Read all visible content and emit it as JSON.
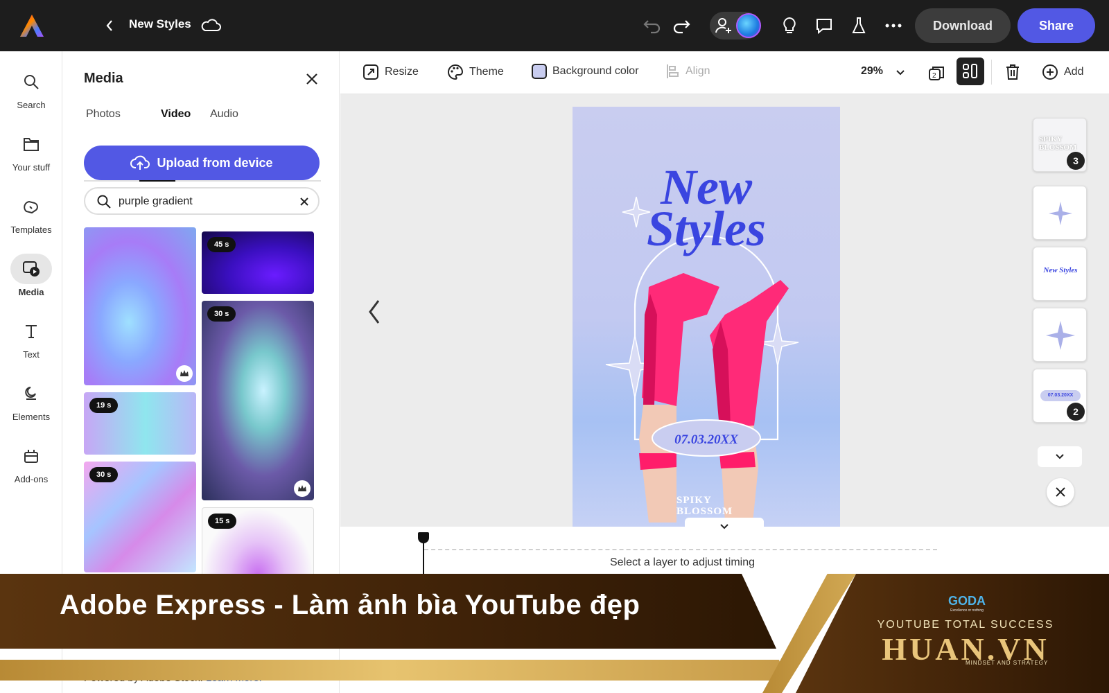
{
  "header": {
    "doc_title": "New Styles",
    "download_label": "Download",
    "share_label": "Share"
  },
  "rail": {
    "items": [
      {
        "label": "Search",
        "icon": "search-icon"
      },
      {
        "label": "Your stuff",
        "icon": "folder-icon"
      },
      {
        "label": "Templates",
        "icon": "templates-icon"
      },
      {
        "label": "Media",
        "icon": "media-icon",
        "active": true
      },
      {
        "label": "Text",
        "icon": "text-icon"
      },
      {
        "label": "Elements",
        "icon": "elements-icon"
      },
      {
        "label": "Add-ons",
        "icon": "addons-icon"
      }
    ]
  },
  "panel": {
    "title": "Media",
    "tabs": [
      {
        "label": "Photos"
      },
      {
        "label": "Video",
        "active": true
      },
      {
        "label": "Audio"
      }
    ],
    "upload_label": "Upload from device",
    "search_value": "purple gradient",
    "durations": [
      "45 s",
      "30 s",
      "19 s",
      "30 s",
      "15 s"
    ],
    "credit_prefix": "Powered by Adobe Stock.",
    "credit_link": "Learn more."
  },
  "toolbar": {
    "resize": "Resize",
    "theme": "Theme",
    "background": "Background color",
    "align": "Align",
    "zoom": "29%",
    "add": "Add"
  },
  "poster": {
    "title_line1": "New",
    "title_line2": "Styles",
    "date": "07.03.20XX",
    "brand": "SPIKY\nBLOSSOM"
  },
  "pages": {
    "badge_first": "3",
    "badge_last": "2",
    "thumb_text": "New Styles",
    "thumb_date": "07.03.20XX",
    "thumb_brand": "SPIKY BLOSSOM"
  },
  "timeline": {
    "hint": "Select a layer to adjust timing"
  },
  "banner": {
    "text": "Adobe Express - Làm ảnh bìa YouTube đẹp",
    "brand_sub": "YOUTUBE TOTAL SUCCESS",
    "brand_name": "HUAN.VN",
    "brand_tag": "MINDSET AND STRATEGY",
    "goda": "GODA",
    "goda_tag": "Excellence or nothing"
  },
  "colors": {
    "accent": "#5258e4",
    "topbar": "#1d1d1d",
    "banner_brown": "#4a2a0c",
    "banner_gold": "#d8b25c"
  }
}
